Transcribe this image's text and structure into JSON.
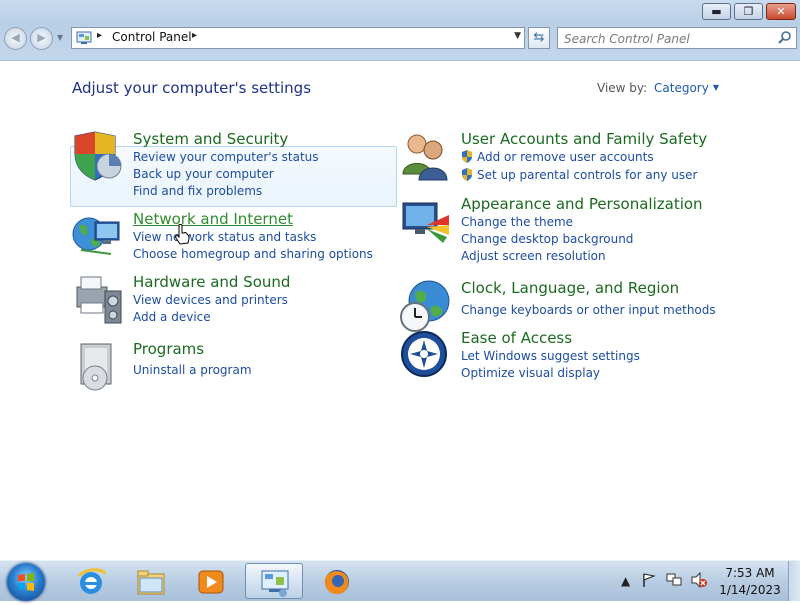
{
  "window": {
    "min_glyph": "▬",
    "max_glyph": "❐",
    "close_glyph": "✕"
  },
  "address_bar": {
    "crumb": "Control Panel",
    "separator": "▸"
  },
  "search": {
    "placeholder": "Search Control Panel"
  },
  "page": {
    "heading": "Adjust your computer's settings",
    "view_by_label": "View by:",
    "view_by_value": "Category"
  },
  "categories": [
    {
      "title": "System and Security",
      "links": [
        "Review your computer's status",
        "Back up your computer",
        "Find and fix problems"
      ],
      "icon": "shield-icon"
    },
    {
      "title": "Network and Internet",
      "links": [
        "View network status and tasks",
        "Choose homegroup and sharing options"
      ],
      "icon": "network-globe-icon",
      "hovered": true
    },
    {
      "title": "Hardware and Sound",
      "links": [
        "View devices and printers",
        "Add a device"
      ],
      "icon": "printer-icon"
    },
    {
      "title": "Programs",
      "links": [
        "Uninstall a program"
      ],
      "icon": "programs-box-icon"
    },
    {
      "title": "User Accounts and Family Safety",
      "links": [
        "Add or remove user accounts",
        "Set up parental controls for any user"
      ],
      "icon": "users-icon"
    },
    {
      "title": "Appearance and Personalization",
      "links": [
        "Change the theme",
        "Change desktop background",
        "Adjust screen resolution"
      ],
      "icon": "monitor-palette-icon"
    },
    {
      "title": "Clock, Language, and Region",
      "links": [
        "Change keyboards or other input methods"
      ],
      "icon": "globe-clock-icon"
    },
    {
      "title": "Ease of Access",
      "links": [
        "Let Windows suggest settings",
        "Optimize visual display"
      ],
      "icon": "ease-of-access-icon"
    }
  ],
  "taskbar": {
    "items": [
      "internet-explorer-icon",
      "file-explorer-icon",
      "media-player-icon",
      "control-panel-icon",
      "firefox-icon"
    ],
    "tray_arrow": "▲",
    "time": "7:53 AM",
    "date": "1/14/2023"
  },
  "colors": {
    "heading": "#1e3287",
    "category_title": "#1a6a1f",
    "link": "#1c4da0"
  }
}
